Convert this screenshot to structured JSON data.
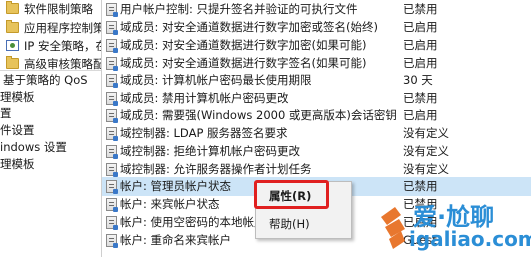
{
  "tree": {
    "items": [
      {
        "label": "软件限制策略",
        "icon": "folder-icon"
      },
      {
        "label": "应用程序控制策略",
        "icon": "folder-icon"
      },
      {
        "label": "IP 安全策略，在",
        "icon": "ipsec-policy-icon"
      },
      {
        "label": "高级审核策略配置",
        "icon": "folder-icon"
      },
      {
        "label": "基于策略的 QoS",
        "icon": ""
      },
      {
        "label": "理模板",
        "icon": ""
      },
      {
        "label": "置",
        "icon": ""
      },
      {
        "label": "件设置",
        "icon": ""
      },
      {
        "label": "indows 设置",
        "icon": ""
      },
      {
        "label": "理模板",
        "icon": ""
      }
    ]
  },
  "policies": [
    {
      "name": "用户帐户控制: 只提升签名并验证的可执行文件",
      "status": "已禁用"
    },
    {
      "name": "域成员: 对安全通道数据进行数字加密或签名(始终)",
      "status": "已启用"
    },
    {
      "name": "域成员: 对安全通道数据进行数字加密(如果可能)",
      "status": "已启用"
    },
    {
      "name": "域成员: 对安全通道数据进行数字签名(如果可能)",
      "status": "已启用"
    },
    {
      "name": "域成员: 计算机帐户密码最长使用期限",
      "status": "30 天"
    },
    {
      "name": "域成员: 禁用计算机帐户密码更改",
      "status": "已禁用"
    },
    {
      "name": "域成员: 需要强(Windows 2000 或更高版本)会话密钥",
      "status": "已启用"
    },
    {
      "name": "域控制器: LDAP 服务器签名要求",
      "status": "没有定义"
    },
    {
      "name": "域控制器: 拒绝计算机帐户密码更改",
      "status": "没有定义"
    },
    {
      "name": "域控制器: 允许服务器操作者计划任务",
      "status": "没有定义"
    },
    {
      "name": "帐户: 管理员帐户状态",
      "status": "已禁用"
    },
    {
      "name": "帐户: 来宾帐户状态",
      "status": "已禁用"
    },
    {
      "name": "帐户: 使用空密码的本地帐户",
      "status": "已启用"
    },
    {
      "name": "帐户: 重命名来宾帐户",
      "status": "Guest"
    }
  ],
  "selected_index": 10,
  "context_menu": {
    "items": [
      {
        "label": "属性(R)",
        "bold": true
      },
      {
        "label": "帮助(H)",
        "bold": false
      }
    ]
  },
  "watermark": {
    "brand": "爱·尬聊",
    "url": "igaliao.com"
  },
  "colors": {
    "selection": "#cce4f7",
    "annotation_box": "#e02020",
    "watermark": "#2b8ed6"
  }
}
